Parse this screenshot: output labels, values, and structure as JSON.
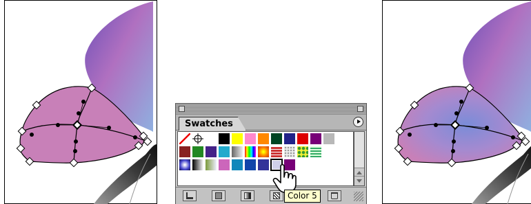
{
  "panel": {
    "tab_label": "Swatches",
    "tooltip": "Color 5"
  },
  "swatch_rows": [
    [
      "none",
      "registration",
      "#ffffff",
      "#000000",
      "#ffff00",
      "#ff88cc",
      "#ff8800",
      "#004422",
      "#222288",
      "#dd0000",
      "#770077",
      "#b8b8b8"
    ],
    [
      "#882222",
      "#228822",
      "#442288",
      "#22aacc",
      "gradient-gray",
      "gradient-spectrum",
      "gradient-radial-orange",
      "pattern-brick",
      "pattern-dots-gray",
      "pattern-dots-yellow",
      "pattern-stripes-green"
    ],
    [
      "gradient-radial-blue",
      "gradient-black-white",
      "gradient-olive",
      "#cc66bb",
      "#1188bb",
      "#1144aa",
      "#333399",
      "#cfcfe8",
      "#770077"
    ]
  ],
  "icons": {
    "close": "close-box-icon",
    "zoom": "zoom-box-icon",
    "menu": "panel-menu-arrow-icon",
    "cursor": "hand-pointer-icon",
    "show_kinds": "show-kinds-icon",
    "color": "color-swatch-icon",
    "gradient": "gradient-swatch-icon",
    "pattern": "pattern-swatch-icon",
    "new_swatch": "new-swatch-icon",
    "delete_swatch": "trash-icon",
    "resize": "resize-grip-icon"
  },
  "colors": {
    "petal_fill": "#c880b8",
    "petal_blue": "#7a8cd8",
    "selected_swatch": "#cfcfe8"
  }
}
